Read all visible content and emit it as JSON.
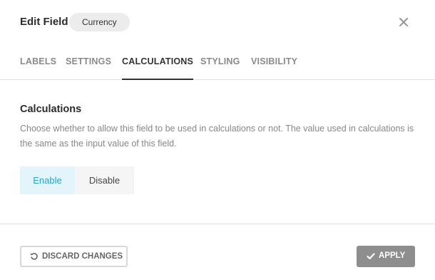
{
  "header": {
    "title": "Edit Field",
    "field_type_badge": "Currency"
  },
  "tabs": [
    {
      "label": "LABELS",
      "active": false
    },
    {
      "label": "SETTINGS",
      "active": false
    },
    {
      "label": "CALCULATIONS",
      "active": true
    },
    {
      "label": "STYLING",
      "active": false
    },
    {
      "label": "VISIBILITY",
      "active": false
    }
  ],
  "section": {
    "title": "Calculations",
    "description": "Choose whether to allow this field to be used in calculations or not. The value used in calculations is the same as the input value of this field."
  },
  "toggle": {
    "enable_label": "Enable",
    "disable_label": "Disable",
    "selected": "Enable"
  },
  "footer": {
    "discard_label": "DISCARD CHANGES",
    "apply_label": "APPLY"
  },
  "colors": {
    "accent": "#2aa3d6",
    "apply_bg": "#8e8e8e"
  },
  "icons": {
    "close": "close-icon",
    "discard": "undo-icon",
    "apply": "checkmark-icon"
  }
}
